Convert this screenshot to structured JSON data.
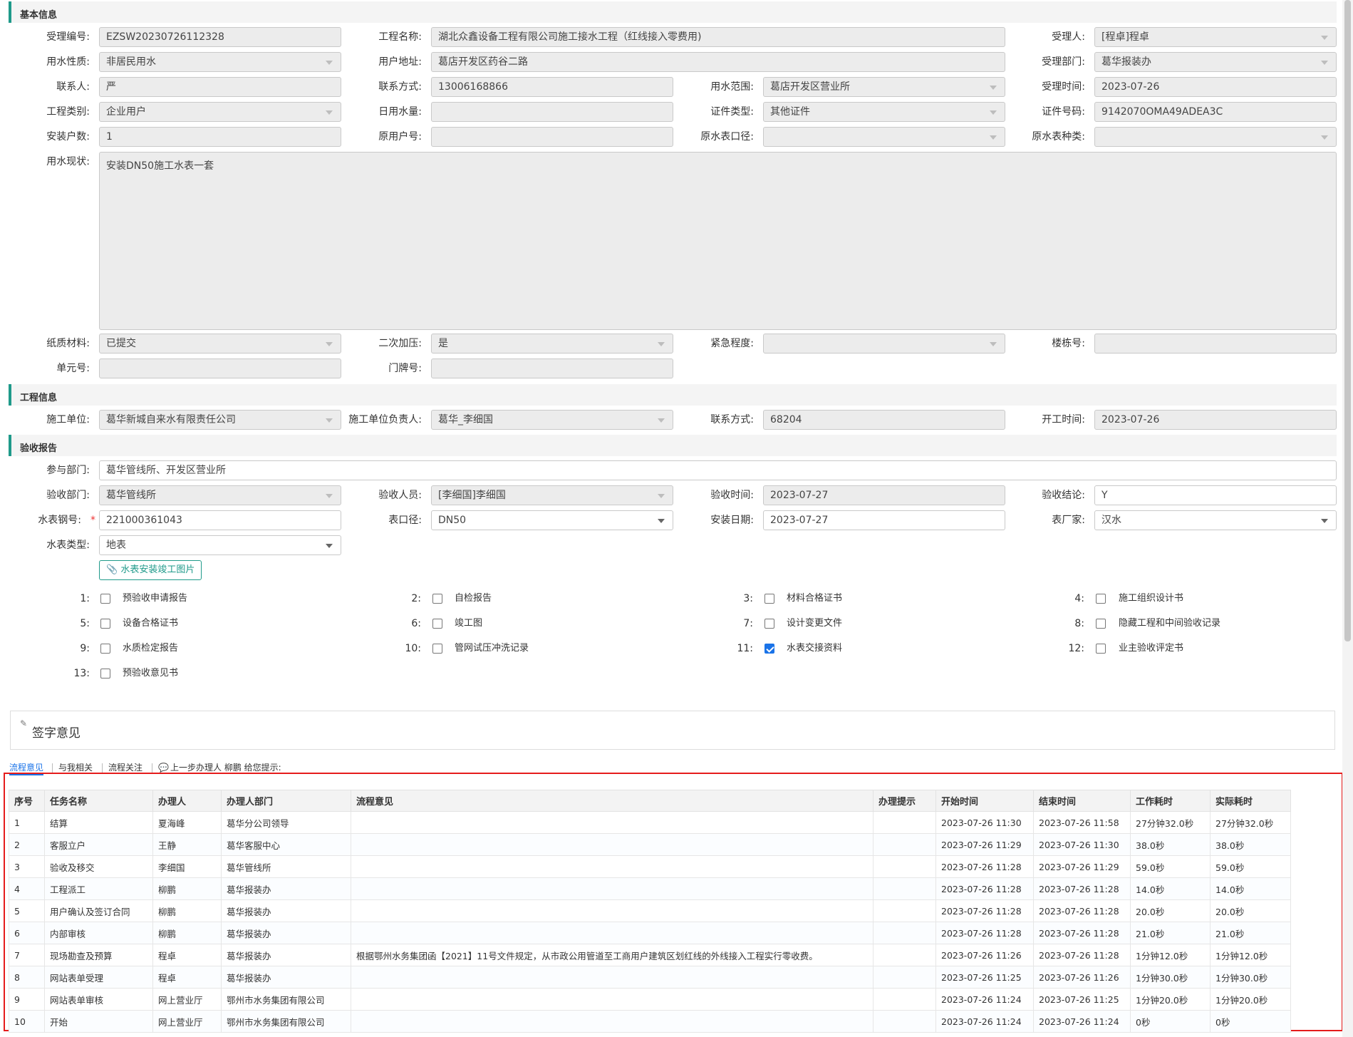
{
  "sections": {
    "basic": "基本信息",
    "project": "工程信息",
    "acceptance": "验收报告"
  },
  "basic": {
    "accept_no": {
      "label": "受理编号:",
      "value": "EZSW20230726112328"
    },
    "project_name": {
      "label": "工程名称:",
      "value": "湖北众鑫设备工程有限公司施工接水工程（红线接入零费用)"
    },
    "handler": {
      "label": "受理人:",
      "value": "[程卓]程卓"
    },
    "water_nature": {
      "label": "用水性质:",
      "value": "非居民用水"
    },
    "user_address": {
      "label": "用户地址:",
      "value": "葛店开发区药谷二路"
    },
    "accept_dept": {
      "label": "受理部门:",
      "value": "葛华报装办"
    },
    "contact": {
      "label": "联系人:",
      "value": "严"
    },
    "contact_phone": {
      "label": "联系方式:",
      "value": "13006168866"
    },
    "water_scope": {
      "label": "用水范围:",
      "value": "葛店开发区营业所"
    },
    "accept_time": {
      "label": "受理时间:",
      "value": "2023-07-26"
    },
    "project_type": {
      "label": "工程类别:",
      "value": "企业用户"
    },
    "daily_water": {
      "label": "日用水量:",
      "value": ""
    },
    "cert_type": {
      "label": "证件类型:",
      "value": "其他证件"
    },
    "cert_no": {
      "label": "证件号码:",
      "value": "9142070OMA49ADEA3C"
    },
    "install_count": {
      "label": "安装户数:",
      "value": "1"
    },
    "orig_user_no": {
      "label": "原用户号:",
      "value": ""
    },
    "orig_meter_caliber": {
      "label": "原水表口径:",
      "value": ""
    },
    "orig_meter_type": {
      "label": "原水表种类:",
      "value": ""
    },
    "water_status": {
      "label": "用水现状:",
      "value": "安装DN50施工水表一套"
    },
    "paper_material": {
      "label": "纸质材料:",
      "value": "已提交"
    },
    "secondary_pressure": {
      "label": "二次加压:",
      "value": "是"
    },
    "urgency": {
      "label": "紧急程度:",
      "value": ""
    },
    "building_no": {
      "label": "楼栋号:",
      "value": ""
    },
    "unit_no": {
      "label": "单元号:",
      "value": ""
    },
    "door_no": {
      "label": "门牌号:",
      "value": ""
    }
  },
  "project": {
    "builder": {
      "label": "施工单位:",
      "value": "葛华新城自来水有限责任公司"
    },
    "builder_leader": {
      "label": "施工单位负责人:",
      "value": "葛华_李细国"
    },
    "phone": {
      "label": "联系方式:",
      "value": "68204"
    },
    "start_time": {
      "label": "开工时间:",
      "value": "2023-07-26"
    }
  },
  "acceptance": {
    "depts": {
      "label": "参与部门:",
      "value": "葛华管线所、开发区营业所"
    },
    "accept_dept": {
      "label": "验收部门:",
      "value": "葛华管线所"
    },
    "accept_person": {
      "label": "验收人员:",
      "value": "[李细国]李细国"
    },
    "accept_time": {
      "label": "验收时间:",
      "value": "2023-07-27"
    },
    "conclusion": {
      "label": "验收结论:",
      "value": "Y"
    },
    "meter_no": {
      "label": "水表钢号:",
      "value": "221000361043",
      "required": "*"
    },
    "caliber": {
      "label": "表口径:",
      "value": "DN50"
    },
    "install_date": {
      "label": "安装日期:",
      "value": "2023-07-27"
    },
    "manufacturer": {
      "label": "表厂家:",
      "value": "汉水"
    },
    "meter_type": {
      "label": "水表类型:",
      "value": "地表"
    },
    "upload_button": "水表安装竣工图片",
    "checklist": [
      {
        "num": "1:",
        "label": "预验收申请报告",
        "checked": false
      },
      {
        "num": "2:",
        "label": "自检报告",
        "checked": false
      },
      {
        "num": "3:",
        "label": "材料合格证书",
        "checked": false
      },
      {
        "num": "4:",
        "label": "施工组织设计书",
        "checked": false
      },
      {
        "num": "5:",
        "label": "设备合格证书",
        "checked": false
      },
      {
        "num": "6:",
        "label": "竣工图",
        "checked": false
      },
      {
        "num": "7:",
        "label": "设计变更文件",
        "checked": false
      },
      {
        "num": "8:",
        "label": "隐藏工程和中间验收记录",
        "checked": false
      },
      {
        "num": "9:",
        "label": "水质检定报告",
        "checked": false
      },
      {
        "num": "10:",
        "label": "管网试压冲洗记录",
        "checked": false
      },
      {
        "num": "11:",
        "label": "水表交接资料",
        "checked": true
      },
      {
        "num": "12:",
        "label": "业主验收评定书",
        "checked": false
      },
      {
        "num": "13:",
        "label": "预验收意见书",
        "checked": false
      }
    ]
  },
  "sign": {
    "title": "签字意见"
  },
  "tabs": {
    "flow_opinion": "流程意见",
    "related": "与我相关",
    "flow_follow": "流程关注",
    "prev_hint": "上一步办理人 柳鹏 给您提示:"
  },
  "table": {
    "headers": [
      "序号",
      "任务名称",
      "办理人",
      "办理人部门",
      "流程意见",
      "办理提示",
      "开始时间",
      "结束时间",
      "工作耗时",
      "实际耗时"
    ],
    "rows": [
      [
        "1",
        "结算",
        "夏海峰",
        "葛华分公司领导",
        "",
        "",
        "2023-07-26 11:30",
        "2023-07-26 11:58",
        "27分钟32.0秒",
        "27分钟32.0秒"
      ],
      [
        "2",
        "客服立户",
        "王静",
        "葛华客服中心",
        "",
        "",
        "2023-07-26 11:29",
        "2023-07-26 11:30",
        "38.0秒",
        "38.0秒"
      ],
      [
        "3",
        "验收及移交",
        "李细国",
        "葛华管线所",
        "",
        "",
        "2023-07-26 11:28",
        "2023-07-26 11:29",
        "59.0秒",
        "59.0秒"
      ],
      [
        "4",
        "工程派工",
        "柳鹏",
        "葛华报装办",
        "",
        "",
        "2023-07-26 11:28",
        "2023-07-26 11:28",
        "14.0秒",
        "14.0秒"
      ],
      [
        "5",
        "用户确认及签订合同",
        "柳鹏",
        "葛华报装办",
        "",
        "",
        "2023-07-26 11:28",
        "2023-07-26 11:28",
        "20.0秒",
        "20.0秒"
      ],
      [
        "6",
        "内部审核",
        "柳鹏",
        "葛华报装办",
        "",
        "",
        "2023-07-26 11:28",
        "2023-07-26 11:28",
        "21.0秒",
        "21.0秒"
      ],
      [
        "7",
        "现场勘查及预算",
        "程卓",
        "葛华报装办",
        "根据鄂州水务集团函【2021】11号文件规定，从市政公用管道至工商用户建筑区划红线的外线接入工程实行零收费。",
        "",
        "2023-07-26 11:26",
        "2023-07-26 11:28",
        "1分钟12.0秒",
        "1分钟12.0秒"
      ],
      [
        "8",
        "网站表单受理",
        "程卓",
        "葛华报装办",
        "",
        "",
        "2023-07-26 11:25",
        "2023-07-26 11:26",
        "1分钟30.0秒",
        "1分钟30.0秒"
      ],
      [
        "9",
        "网站表单审核",
        "网上营业厅",
        "鄂州市水务集团有限公司",
        "",
        "",
        "2023-07-26 11:24",
        "2023-07-26 11:25",
        "1分钟20.0秒",
        "1分钟20.0秒"
      ],
      [
        "10",
        "开始",
        "网上营业厅",
        "鄂州市水务集团有限公司",
        "",
        "",
        "2023-07-26 11:24",
        "2023-07-26 11:24",
        "0秒",
        "0秒"
      ]
    ]
  }
}
